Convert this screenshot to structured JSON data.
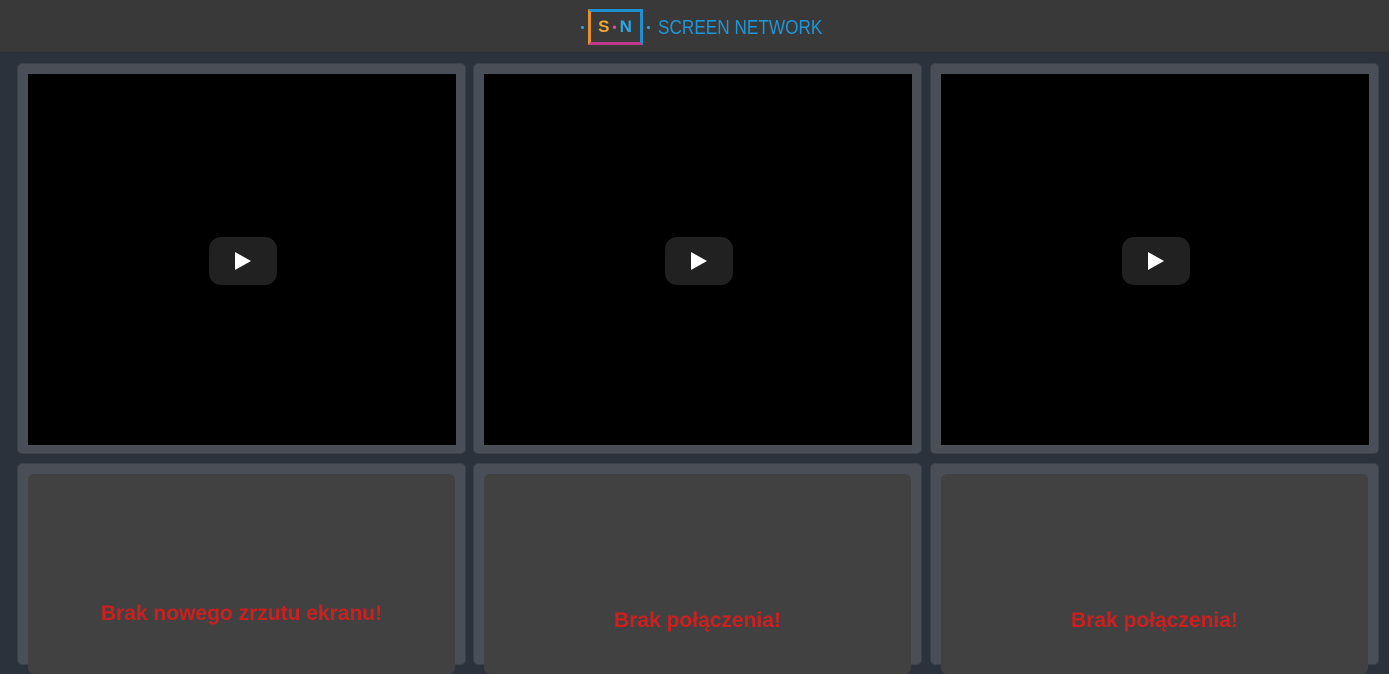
{
  "header": {
    "logo_letters": {
      "s": "S",
      "sep": "•",
      "n": "N"
    },
    "brand_text": "SCREEN NETWORK",
    "brand_color": "#1f96d6"
  },
  "video_tiles": [
    {
      "play_icon": "play-icon"
    },
    {
      "play_icon": "play-icon"
    },
    {
      "play_icon": "play-icon"
    }
  ],
  "screen_tiles": [
    {
      "message": "Brak nowego zrzutu ekranu!"
    },
    {
      "message": "Brak połączenia!"
    },
    {
      "message": "Brak połączenia!"
    }
  ],
  "colors": {
    "page_bg": "#2b323c",
    "header_bg": "#393939",
    "tile_bg": "#4a4f57",
    "error_text": "#cc1f1f"
  }
}
